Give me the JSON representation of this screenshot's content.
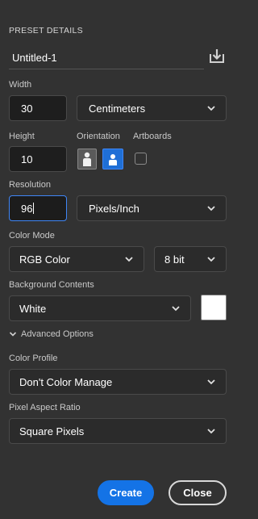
{
  "panel": {
    "section_title": "PRESET DETAILS",
    "preset_name": "Untitled-1",
    "save_preset_icon": "save-preset-icon"
  },
  "width": {
    "label": "Width",
    "value": "30",
    "unit": "Centimeters"
  },
  "height": {
    "label": "Height",
    "value": "10"
  },
  "orientation": {
    "label": "Orientation",
    "selected": "landscape"
  },
  "artboards": {
    "label": "Artboards",
    "checked": false
  },
  "resolution": {
    "label": "Resolution",
    "value": "96",
    "unit": "Pixels/Inch"
  },
  "color_mode": {
    "label": "Color Mode",
    "mode": "RGB Color",
    "depth": "8 bit"
  },
  "background": {
    "label": "Background Contents",
    "value": "White",
    "swatch_color": "#ffffff"
  },
  "advanced": {
    "label": "Advanced Options",
    "expanded": true
  },
  "color_profile": {
    "label": "Color Profile",
    "value": "Don't Color Manage"
  },
  "pixel_aspect": {
    "label": "Pixel Aspect Ratio",
    "value": "Square Pixels"
  },
  "actions": {
    "create_label": "Create",
    "close_label": "Close"
  },
  "colors": {
    "panel_bg": "#323232",
    "accent": "#1473e6",
    "focus": "#3f86f6"
  }
}
